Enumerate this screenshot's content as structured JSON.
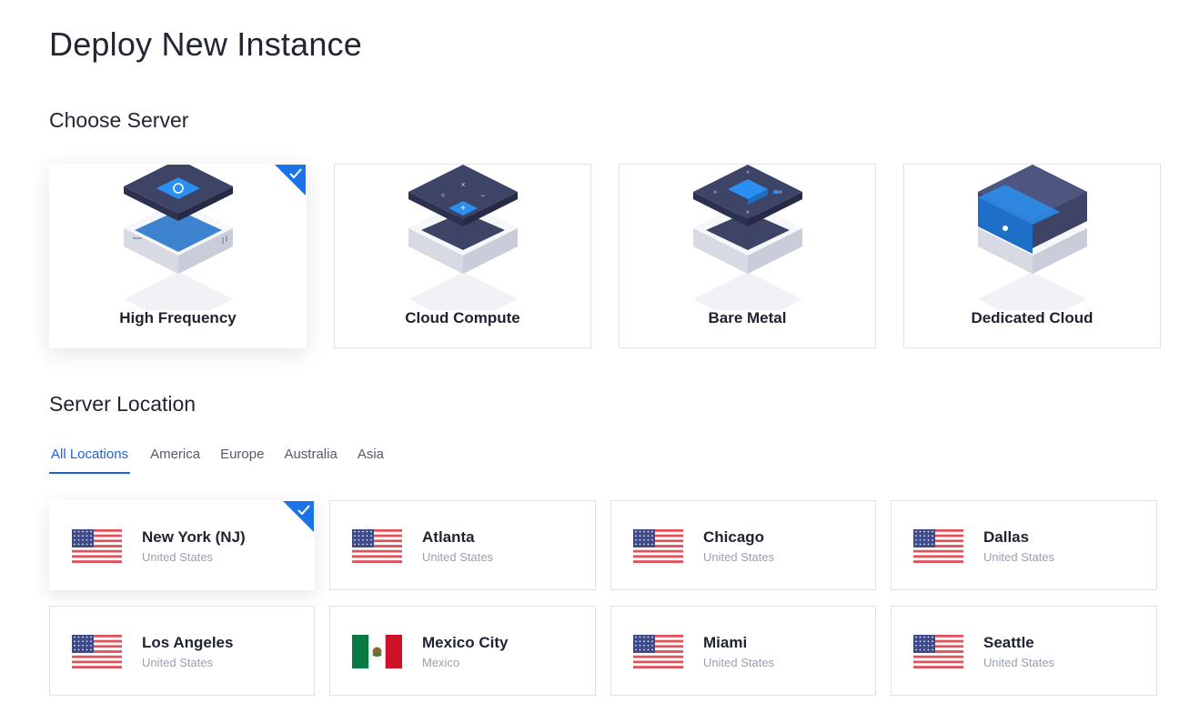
{
  "page": {
    "title": "Deploy New Instance"
  },
  "choose_server": {
    "heading": "Choose Server",
    "options": [
      {
        "label": "High Frequency",
        "selected": true,
        "icon": "high-frequency-server-icon"
      },
      {
        "label": "Cloud Compute",
        "selected": false,
        "icon": "cloud-compute-server-icon"
      },
      {
        "label": "Bare Metal",
        "selected": false,
        "icon": "bare-metal-server-icon"
      },
      {
        "label": "Dedicated Cloud",
        "selected": false,
        "icon": "dedicated-cloud-server-icon"
      }
    ]
  },
  "server_location": {
    "heading": "Server Location",
    "tabs": [
      {
        "label": "All Locations",
        "active": true
      },
      {
        "label": "America",
        "active": false
      },
      {
        "label": "Europe",
        "active": false
      },
      {
        "label": "Australia",
        "active": false
      },
      {
        "label": "Asia",
        "active": false
      }
    ],
    "locations": [
      {
        "city": "New York (NJ)",
        "country": "United States",
        "flag": "us-flag-icon",
        "selected": true
      },
      {
        "city": "Atlanta",
        "country": "United States",
        "flag": "us-flag-icon",
        "selected": false
      },
      {
        "city": "Chicago",
        "country": "United States",
        "flag": "us-flag-icon",
        "selected": false
      },
      {
        "city": "Dallas",
        "country": "United States",
        "flag": "us-flag-icon",
        "selected": false
      },
      {
        "city": "Los Angeles",
        "country": "United States",
        "flag": "us-flag-icon",
        "selected": false
      },
      {
        "city": "Mexico City",
        "country": "Mexico",
        "flag": "mexico-flag-icon",
        "selected": false
      },
      {
        "city": "Miami",
        "country": "United States",
        "flag": "us-flag-icon",
        "selected": false
      },
      {
        "city": "Seattle",
        "country": "United States",
        "flag": "us-flag-icon",
        "selected": false
      }
    ]
  },
  "colors": {
    "accent": "#1e63d6",
    "selected_check": "#1a73e8",
    "server_dark": "#3d4466",
    "server_blue": "#2a8ff0"
  }
}
